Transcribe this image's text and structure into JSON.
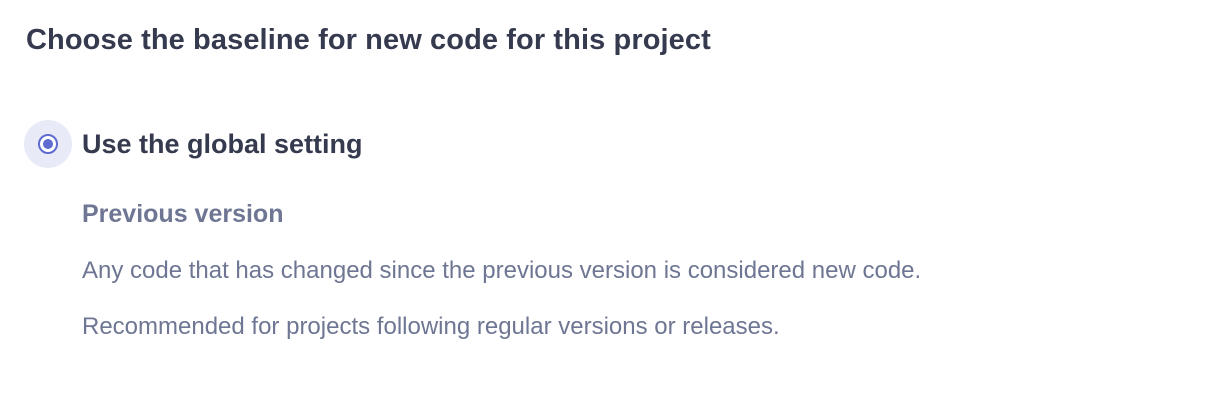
{
  "heading": "Choose the baseline for new code for this project",
  "option": {
    "label": "Use the global setting",
    "selected": true,
    "accent_color": "#5d6cd0"
  },
  "global_setting": {
    "title": "Previous version",
    "description_lines": [
      "Any code that has changed since the previous version is considered new code.",
      "Recommended for projects following regular versions or releases."
    ]
  }
}
